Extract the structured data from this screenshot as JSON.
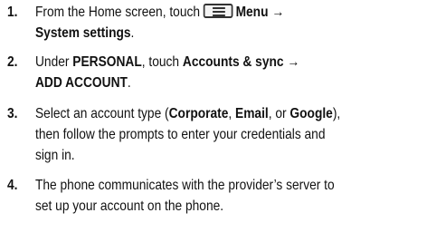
{
  "steps": [
    {
      "number": "1.",
      "line1_pre": "From the Home screen, touch",
      "icon": "menu-icon",
      "line1_bold": "Menu →",
      "line2_bold": "System settings",
      "line2_post": "."
    },
    {
      "number": "2.",
      "line1_pre": "Under ",
      "line1_bold1": "PERSONAL",
      "line1_mid": ", touch ",
      "line1_bold2": "Accounts & sync →",
      "line2_bold": "ADD ACCOUNT",
      "line2_post": "."
    },
    {
      "number": "3.",
      "line1_pre": "Select an account type (",
      "line1_bold1": "Corporate",
      "line1_mid1": ", ",
      "line1_bold2": "Email",
      "line1_mid2": ", or ",
      "line1_bold3": "Google",
      "line1_post": "),",
      "line2": "then follow the prompts to enter your credentials and",
      "line3": "sign in."
    },
    {
      "number": "4.",
      "line1": "The phone communicates with the provider’s server to",
      "line2": "set up your account on the phone."
    }
  ]
}
